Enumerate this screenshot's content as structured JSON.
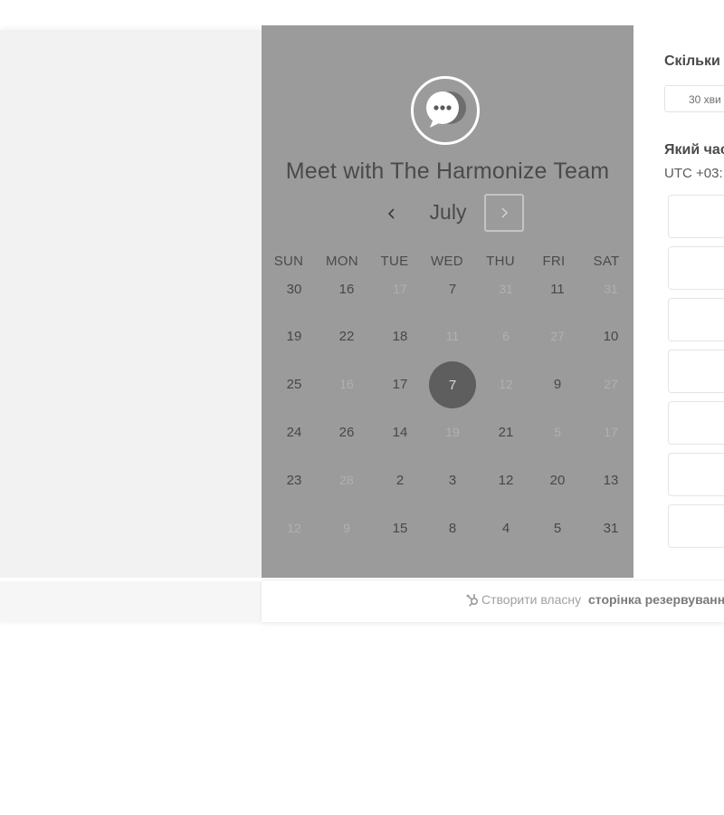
{
  "calendar": {
    "title": "Meet with The Harmonize Team",
    "month": "July",
    "weekdays": [
      "SUN",
      "MON",
      "TUE",
      "WED",
      "THU",
      "FRI",
      "SAT"
    ],
    "selected_day": "7",
    "weeks": [
      [
        {
          "d": "30",
          "m": false
        },
        {
          "d": "16",
          "m": false
        },
        {
          "d": "17",
          "m": true
        },
        {
          "d": "7",
          "m": false
        },
        {
          "d": "31",
          "m": true
        },
        {
          "d": "11",
          "m": false
        },
        {
          "d": "31",
          "m": true
        }
      ],
      [
        {
          "d": "19",
          "m": false
        },
        {
          "d": "22",
          "m": false
        },
        {
          "d": "18",
          "m": false
        },
        {
          "d": "11",
          "m": true
        },
        {
          "d": "6",
          "m": true
        },
        {
          "d": "27",
          "m": true
        },
        {
          "d": "10",
          "m": false
        }
      ],
      [
        {
          "d": "25",
          "m": false
        },
        {
          "d": "16",
          "m": true
        },
        {
          "d": "17",
          "m": false
        },
        {
          "d": "7",
          "m": false,
          "sel": true
        },
        {
          "d": "12",
          "m": true
        },
        {
          "d": "9",
          "m": false
        },
        {
          "d": "27",
          "m": true
        }
      ],
      [
        {
          "d": "24",
          "m": false
        },
        {
          "d": "26",
          "m": false
        },
        {
          "d": "14",
          "m": false
        },
        {
          "d": "19",
          "m": true
        },
        {
          "d": "21",
          "m": false
        },
        {
          "d": "5",
          "m": true
        },
        {
          "d": "17",
          "m": true
        }
      ],
      [
        {
          "d": "23",
          "m": false
        },
        {
          "d": "28",
          "m": true
        },
        {
          "d": "2",
          "m": false
        },
        {
          "d": "3",
          "m": false
        },
        {
          "d": "12",
          "m": false
        },
        {
          "d": "20",
          "m": false
        },
        {
          "d": "13",
          "m": false
        }
      ],
      [
        {
          "d": "12",
          "m": true
        },
        {
          "d": "9",
          "m": true
        },
        {
          "d": "15",
          "m": false
        },
        {
          "d": "8",
          "m": false
        },
        {
          "d": "4",
          "m": false
        },
        {
          "d": "5",
          "m": false
        },
        {
          "d": "31",
          "m": false
        }
      ]
    ]
  },
  "booking": {
    "duration_question": "Скільки",
    "duration_value": "30 хви",
    "time_question": "Який час",
    "timezone": "UTC +03:"
  },
  "footer": {
    "text": "Створити власну",
    "bold": "сторінка резервуванн"
  },
  "icons": {
    "avatar": "chat-bubble-icon",
    "prev": "chevron-left-icon",
    "next": "chevron-right-icon",
    "footer": "hubspot-sprocket-icon"
  },
  "colors": {
    "panel": "#9b9b9b",
    "selected_day": "#5e5e5e",
    "text_dark": "#4a4a4a",
    "text_muted": "#b0b0b0"
  }
}
